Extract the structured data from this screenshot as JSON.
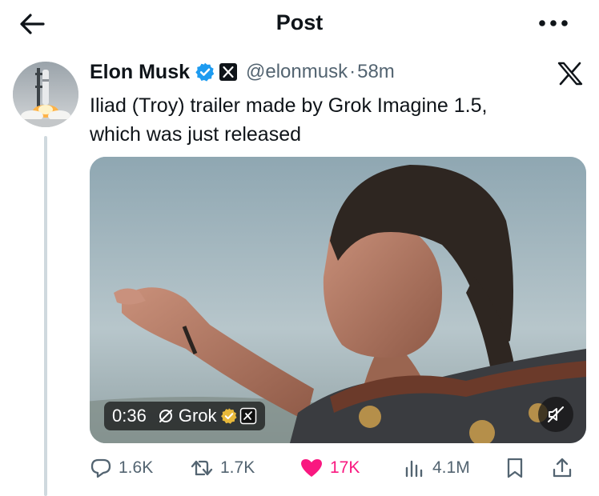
{
  "header": {
    "title": "Post",
    "back_icon": "arrow-left-icon",
    "more_icon": "more-horizontal-icon"
  },
  "author": {
    "name": "Elon Musk",
    "handle": "@elonmusk",
    "separator": "·",
    "time": "58m",
    "verified_color": "#1d9bf0",
    "affiliate_badge": "x-logo-badge"
  },
  "tweet": {
    "lines": [
      "Iliad (Troy) trailer made by Grok Imagine 1.5,",
      "which was just released"
    ]
  },
  "media": {
    "duration": "0:36",
    "source_label": "Grok",
    "badge_color": "#e8b93b",
    "mute_icon": "muted-speaker-icon"
  },
  "actions": {
    "replies": "1.6K",
    "reposts": "1.7K",
    "likes": "17K",
    "views": "4.1M",
    "like_color": "#f91880"
  }
}
